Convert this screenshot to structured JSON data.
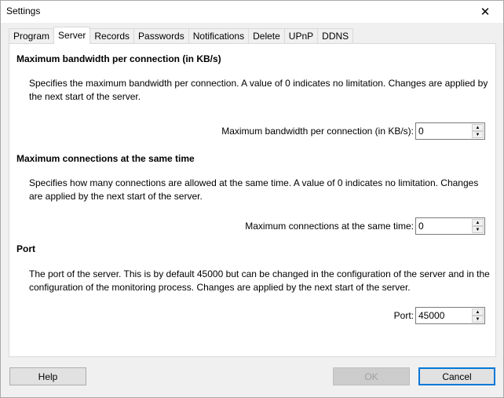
{
  "window": {
    "title": "Settings",
    "close_glyph": "✕"
  },
  "tabs": [
    {
      "label": "Program",
      "active": false
    },
    {
      "label": "Server",
      "active": true
    },
    {
      "label": "Records",
      "active": false
    },
    {
      "label": "Passwords",
      "active": false
    },
    {
      "label": "Notifications",
      "active": false
    },
    {
      "label": "Delete",
      "active": false
    },
    {
      "label": "UPnP",
      "active": false
    },
    {
      "label": "DDNS",
      "active": false
    }
  ],
  "sections": {
    "bandwidth": {
      "title": "Maximum bandwidth per connection (in KB/s)",
      "description": "Specifies the maximum bandwidth per connection. A value of 0 indicates no limitation. Changes are applied by the next start of the server.",
      "field_label": "Maximum bandwidth per connection (in KB/s):",
      "value": "0"
    },
    "connections": {
      "title": "Maximum connections at the same time",
      "description": "Specifies how many connections are allowed at the same time. A value of 0 indicates no limitation. Changes are applied by the next start of the server.",
      "field_label": "Maximum connections at the same time:",
      "value": "0"
    },
    "port": {
      "title": "Port",
      "description": "The port of the server. This is by default 45000 but can be changed in the configuration of the server and in the configuration of the monitoring process. Changes are applied by the next start of the server.",
      "field_label": "Port:",
      "value": "45000"
    }
  },
  "spin_glyphs": {
    "up": "▲",
    "down": "▼"
  },
  "buttons": {
    "help": "Help",
    "ok": "OK",
    "cancel": "Cancel"
  }
}
